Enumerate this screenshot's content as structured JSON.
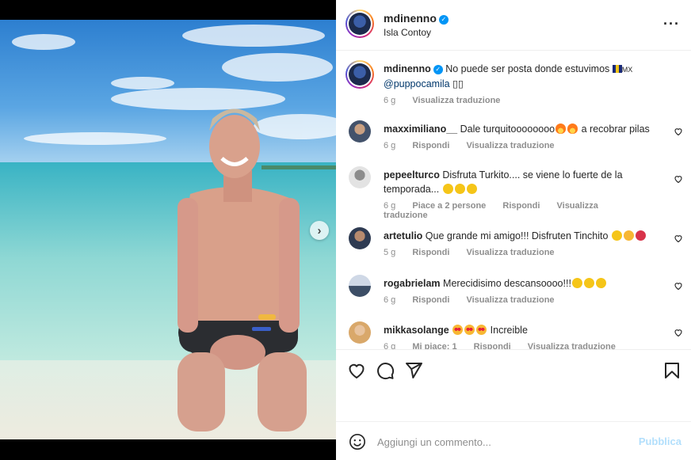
{
  "post": {
    "username": "mdinenno",
    "location": "Isla Contoy",
    "caption_text": "No puede ser posta donde estuvimos",
    "caption_flag": "MX",
    "caption_mention": "@puppocamila",
    "caption_tail": "▯▯",
    "caption_age": "6 g",
    "caption_translate": "Visualizza traduzione"
  },
  "comments": [
    {
      "user": "maxximiliano__",
      "text_before": "Dale turquitoooooooo",
      "emojis": [
        "fire-emoji",
        "fire-emoji"
      ],
      "text_after": "a recobrar pilas",
      "age": "6 g",
      "likes": "",
      "reply": "Rispondi",
      "translate": "Visualizza traduzione"
    },
    {
      "user": "pepeelturco",
      "text_before": "Disfruta Turkito.... se viene lo fuerte de la temporada...",
      "emojis": [
        "muscle-emoji",
        "muscle-emoji",
        "muscle-emoji"
      ],
      "text_after": "",
      "age": "6 g",
      "likes": "Piace a 2 persone",
      "reply": "Rispondi",
      "translate": "Visualizza traduzione"
    },
    {
      "user": "artetulio",
      "text_before": "Que grande mi amigo!!! Disfruten Tinchito",
      "emojis": [
        "raised-hands-emoji",
        "face-emoji",
        "bow-emoji"
      ],
      "text_after": "",
      "age": "5 g",
      "likes": "",
      "reply": "Rispondi",
      "translate": "Visualizza traduzione"
    },
    {
      "user": "rogabrielam",
      "text_before": "Merecidisimo descansoooo!!!",
      "emojis": [
        "clap-emoji",
        "clap-emoji",
        "clap-emoji"
      ],
      "text_after": "",
      "age": "6 g",
      "likes": "",
      "reply": "Rispondi",
      "translate": "Visualizza traduzione"
    },
    {
      "user": "mikkasolange",
      "text_before": "",
      "emojis": [
        "heart-eyes-emoji",
        "heart-eyes-emoji",
        "heart-eyes-emoji"
      ],
      "text_after": "Increible",
      "age": "6 g",
      "likes": "Mi piace: 1",
      "reply": "Rispondi",
      "translate": "Visualizza traduzione"
    }
  ],
  "actions": {
    "icons": [
      "heart-icon",
      "comment-icon",
      "share-icon",
      "bookmark-icon"
    ]
  },
  "composer": {
    "placeholder": "Aggiungi un commento...",
    "publish_label": "Pubblica"
  },
  "colors": {
    "link": "#00376b",
    "publish_disabled": "#b2dffc",
    "verified": "#0095f6",
    "meta": "#8e8e8e"
  }
}
